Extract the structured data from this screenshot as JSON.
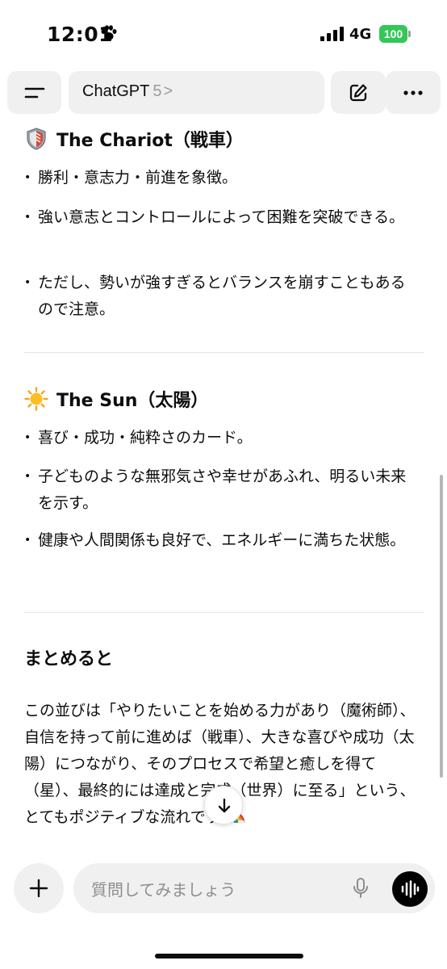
{
  "status_bar": {
    "time": "12:01",
    "network": "4G",
    "battery": "100"
  },
  "header": {
    "title": "ChatGPT",
    "version": "5",
    "chevron": ">"
  },
  "sections": {
    "chariot": {
      "title": "The Chariot（戦車）",
      "emoji": "chariot-shield-emoji",
      "bullets": [
        "勝利・意志力・前進を象徴。",
        "強い意志とコントロールによって困難を突破できる。",
        "ただし、勢いが強すぎるとバランスを崩すこともあるので注意。"
      ]
    },
    "sun": {
      "title": "The Sun（太陽）",
      "emoji": "sun-emoji",
      "bullets": [
        "喜び・成功・純粋さのカード。",
        "子どものような無邪気さや幸せがあふれ、明るい未来を示す。",
        "健康や人間関係も良好で、エネルギーに満ちた状態。"
      ]
    },
    "summary": {
      "title": "まとめると",
      "body": "この並びは「やりたいことを始める力があり（魔術師）、自信を持って前に進めば（戦車）、大きな喜びや成功（太陽）につながり、そのプロセスで希望と癒しを得て（星）、最終的には達成と完成（世界）に至る」という、とてもポジティブな流れです"
    }
  },
  "composer": {
    "placeholder": "質問してみましょう"
  },
  "colors": {
    "battery": "#33c759",
    "pill_bg": "#f0f0f0",
    "placeholder": "#8e8e8e"
  }
}
